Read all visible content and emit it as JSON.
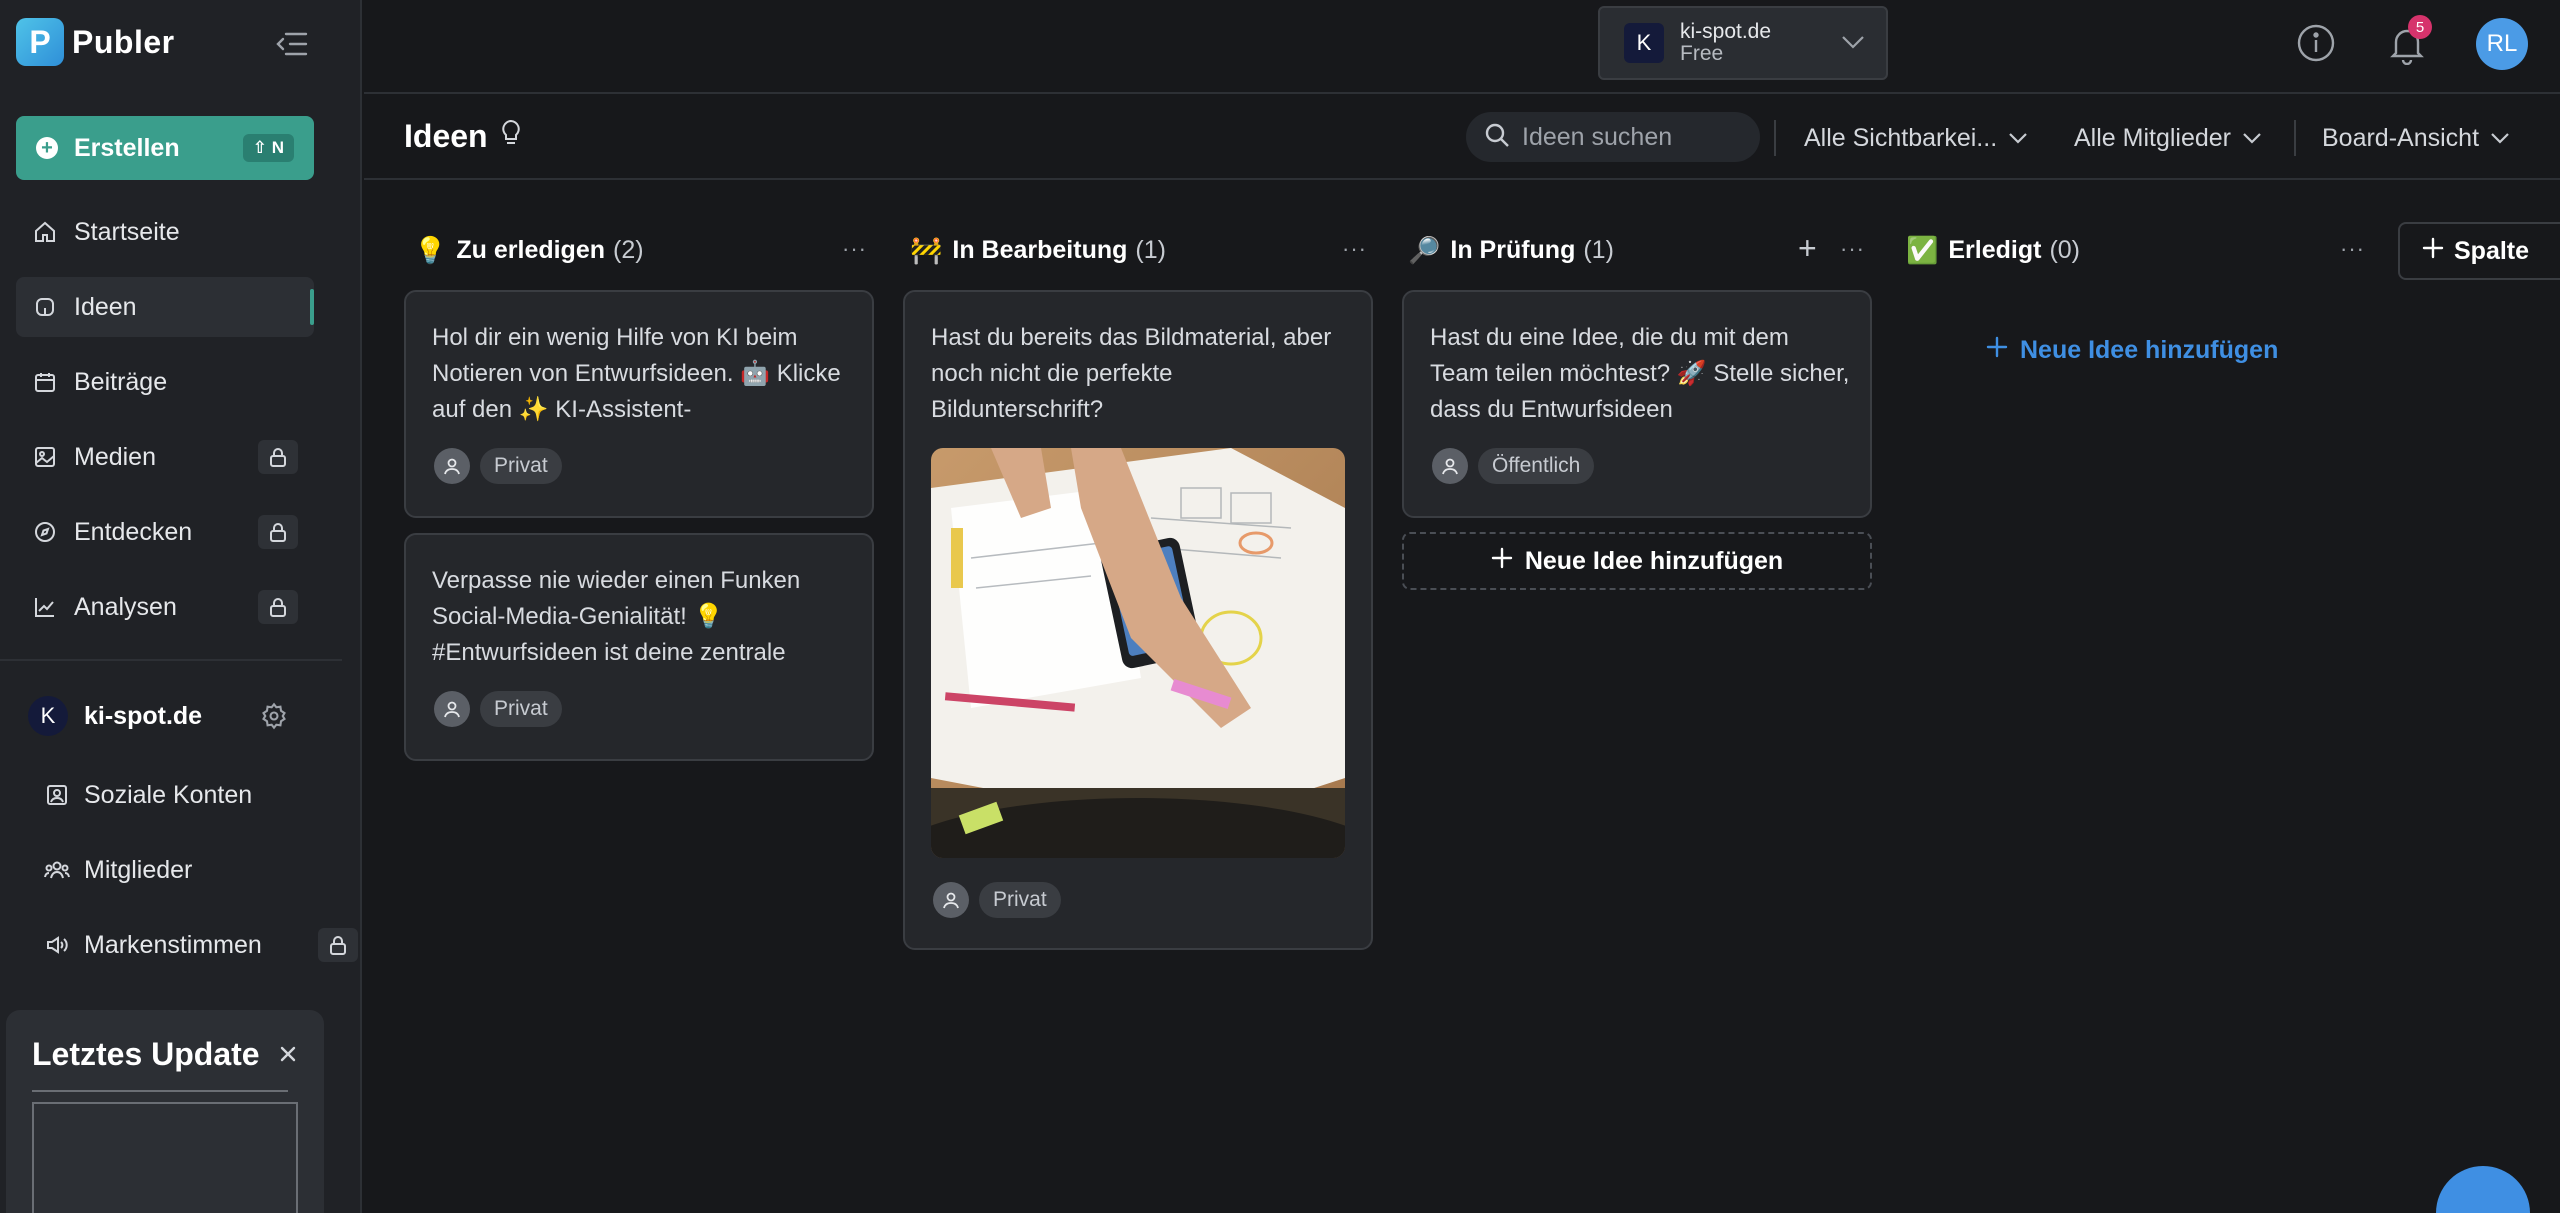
{
  "sidebar": {
    "logo": "Publer",
    "create": {
      "label": "Erstellen",
      "shortcut": "⇧ N"
    },
    "nav": [
      {
        "label": "Startseite",
        "icon": "home-icon",
        "locked": false
      },
      {
        "label": "Ideen",
        "icon": "lightbulb-icon",
        "locked": false,
        "active": true
      },
      {
        "label": "Beiträge",
        "icon": "calendar-icon",
        "locked": false
      },
      {
        "label": "Medien",
        "icon": "image-icon",
        "locked": true
      },
      {
        "label": "Entdecken",
        "icon": "compass-icon",
        "locked": true
      },
      {
        "label": "Analysen",
        "icon": "chart-icon",
        "locked": true
      }
    ],
    "workspace": {
      "initial": "K",
      "name": "ki-spot.de"
    },
    "sub_nav": [
      {
        "label": "Soziale Konten",
        "icon": "accounts-icon",
        "locked": false
      },
      {
        "label": "Mitglieder",
        "icon": "members-icon",
        "locked": false
      },
      {
        "label": "Markenstimmen",
        "icon": "megaphone-icon",
        "locked": true
      }
    ],
    "update_panel": {
      "title": "Letztes Update"
    }
  },
  "topbar": {
    "account": {
      "initial": "K",
      "name": "ki-spot.de",
      "plan": "Free"
    },
    "notifications": "5",
    "user_initials": "RL"
  },
  "header": {
    "title": "Ideen",
    "search_placeholder": "Ideen suchen",
    "filters": [
      "Alle Sichtbarkei...",
      "Alle Mitglieder",
      "Board-Ansicht"
    ]
  },
  "board": {
    "columns": [
      {
        "emoji": "💡",
        "title": "Zu erledigen",
        "count": "(2)",
        "cards": [
          {
            "text": "Hol dir ein wenig Hilfe von KI beim Notieren von Entwurfsideen. 🤖 Klicke auf den ✨ KI-Assistent-",
            "visibility": "Privat"
          },
          {
            "text": "Verpasse nie wieder einen Funken Social-Media-Genialität! 💡 #Entwurfsideen ist deine zentrale",
            "visibility": "Privat"
          }
        ]
      },
      {
        "emoji": "🚧",
        "title": "In Bearbeitung",
        "count": "(1)",
        "cards": [
          {
            "text": "Hast du bereits das Bildmaterial, aber noch nicht die perfekte Bildunterschrift?",
            "visibility": "Privat"
          }
        ]
      },
      {
        "emoji": "🔎",
        "title": "In Prüfung",
        "count": "(1)",
        "cards": [
          {
            "text": "Hast du eine Idee, die du mit dem Team teilen möchtest? 🚀 Stelle sicher, dass du Entwurfsideen",
            "visibility": "Öffentlich"
          }
        ],
        "add_label": "Neue Idee hinzufügen"
      },
      {
        "emoji": "✅",
        "title": "Erledigt",
        "count": "(0)",
        "add_label": "Neue Idee hinzufügen"
      }
    ],
    "add_column_label": "Spalte"
  },
  "colors": {
    "accent": "#3a9e8c",
    "link": "#3f8fe3",
    "badge": "#d6336c",
    "avatar": "#4b9be6"
  }
}
